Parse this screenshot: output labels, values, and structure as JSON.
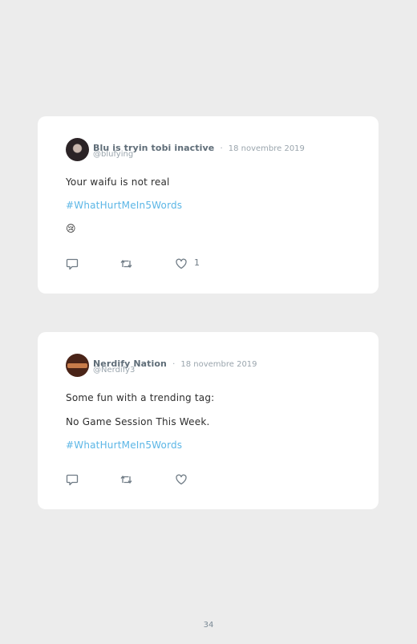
{
  "tweets": [
    {
      "author_name": "Blu is tryin tobi inactive",
      "separator": "·",
      "date": "18 novembre 2019",
      "handle": "@blufying",
      "lines": [
        "Your waifu is not real"
      ],
      "hashtag": "#WhatHurtMeIn5Words",
      "emoji": "😢",
      "like_count": "1",
      "icons": [
        "reply-icon",
        "retweet-icon",
        "like-icon"
      ]
    },
    {
      "author_name": "Nerdify Nation",
      "separator": "·",
      "date": "18 novembre 2019",
      "handle": "@Nerdify3",
      "lines": [
        "Some fun with a trending tag:",
        "No Game Session This Week."
      ],
      "hashtag": "#WhatHurtMeIn5Words",
      "like_count": "",
      "icons": [
        "reply-icon",
        "retweet-icon",
        "like-icon"
      ]
    }
  ],
  "page_number": "34",
  "colors": {
    "background": "#ececec",
    "card": "#ffffff",
    "hashtag": "#5bb6e6",
    "name": "#5f6d78",
    "muted": "#9aa5ad"
  }
}
